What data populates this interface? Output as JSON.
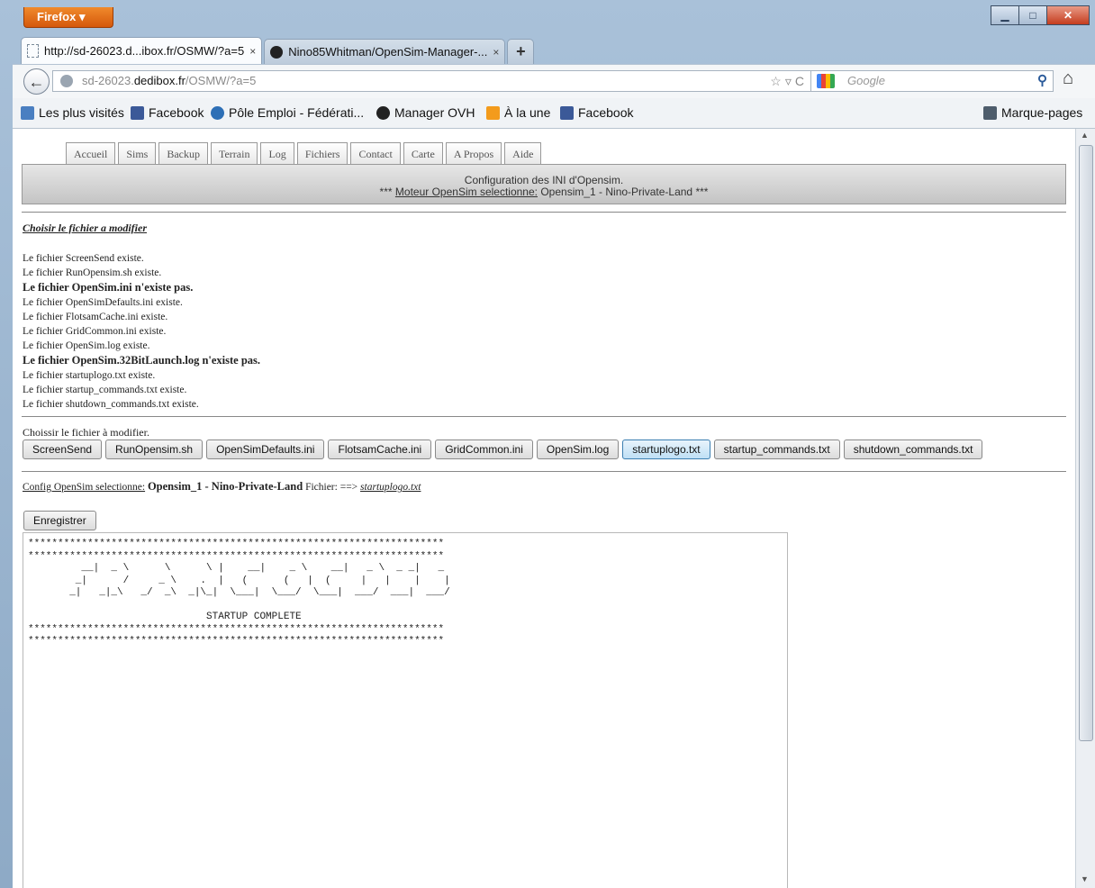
{
  "browser": {
    "app_button": "Firefox ▾",
    "window_controls": {
      "minimize": "▁",
      "maximize": "□",
      "close": "✕"
    },
    "tabs": [
      {
        "title": "http://sd-26023.d...ibox.fr/OSMW/?a=5",
        "close": "×"
      },
      {
        "title": "Nino85Whitman/OpenSim-Manager-...",
        "close": "×"
      }
    ],
    "new_tab": "+",
    "back": "←",
    "url": {
      "prefix": "sd-26023.",
      "domain": "dedibox.fr",
      "path": "/OSMW/?a=5",
      "right_icons": "☆▿C"
    },
    "search": {
      "placeholder": "Google",
      "icon": "⚲"
    },
    "home": "⌂",
    "bookmarks": [
      {
        "label": "Les plus visités"
      },
      {
        "label": "Facebook"
      },
      {
        "label": "Pôle Emploi - Fédérati..."
      },
      {
        "label": "Manager OVH"
      },
      {
        "label": "À la une"
      },
      {
        "label": "Facebook"
      }
    ],
    "bookmarks_menu": "Marque-pages"
  },
  "page": {
    "nav_tabs": [
      "Accueil",
      "Sims",
      "Backup",
      "Terrain",
      "Log",
      "Fichiers",
      "Contact",
      "Carte",
      "A Propos",
      "Aide"
    ],
    "banner": {
      "title": "Configuration des INI d'Opensim.",
      "stars": "***",
      "engine_label": "Moteur OpenSim selectionne:",
      "engine_value": "Opensim_1 - Nino-Private-Land"
    },
    "choose_title": "Choisir le fichier a modifier",
    "status_lines": [
      {
        "text": "Le fichier ScreenSend existe.",
        "bold": false
      },
      {
        "text": "Le fichier RunOpensim.sh existe.",
        "bold": false
      },
      {
        "text": "Le fichier OpenSim.ini n'existe pas.",
        "bold": true
      },
      {
        "text": "Le fichier OpenSimDefaults.ini existe.",
        "bold": false
      },
      {
        "text": "Le fichier FlotsamCache.ini existe.",
        "bold": false
      },
      {
        "text": "Le fichier GridCommon.ini existe.",
        "bold": false
      },
      {
        "text": "Le fichier OpenSim.log existe.",
        "bold": false
      },
      {
        "text": "Le fichier OpenSim.32BitLaunch.log n'existe pas.",
        "bold": true
      },
      {
        "text": "Le fichier startuplogo.txt existe.",
        "bold": false
      },
      {
        "text": "Le fichier startup_commands.txt existe.",
        "bold": false
      },
      {
        "text": "Le fichier shutdown_commands.txt existe.",
        "bold": false
      }
    ],
    "choose_prompt": "Choissir le fichier à modifier.",
    "file_buttons": [
      {
        "label": "ScreenSend",
        "selected": false
      },
      {
        "label": "RunOpensim.sh",
        "selected": false
      },
      {
        "label": "OpenSimDefaults.ini",
        "selected": false
      },
      {
        "label": "FlotsamCache.ini",
        "selected": false
      },
      {
        "label": "GridCommon.ini",
        "selected": false
      },
      {
        "label": "OpenSim.log",
        "selected": false
      },
      {
        "label": "startuplogo.txt",
        "selected": true
      },
      {
        "label": "startup_commands.txt",
        "selected": false
      },
      {
        "label": "shutdown_commands.txt",
        "selected": false
      }
    ],
    "config_line": {
      "label": "Config OpenSim selectionne:",
      "value": "Opensim_1 - Nino-Private-Land",
      "file_label": "Fichier: ==>",
      "file_value": "startuplogo.txt"
    },
    "save_button": "Enregistrer",
    "editor_text": "**********************************************************************\n**********************************************************************\n         __|  _ \\      \\      \\ |    __|    _ \\    __|   _ \\  _ _|   _ \n        _|      /     _ \\    .  |   (      (   |  (     |   |    |    | \n       _|   _|_\\   _/  _\\  _|\\_|  \\___|  \\___/  \\___|  ___/  ___|  ___/ \n\n                              STARTUP COMPLETE\n**********************************************************************\n**********************************************************************"
  },
  "colors": {
    "selected_button": "#bfdff5",
    "firefox_orange": "#e06a12",
    "banner_gray": "#d0d0d0"
  }
}
